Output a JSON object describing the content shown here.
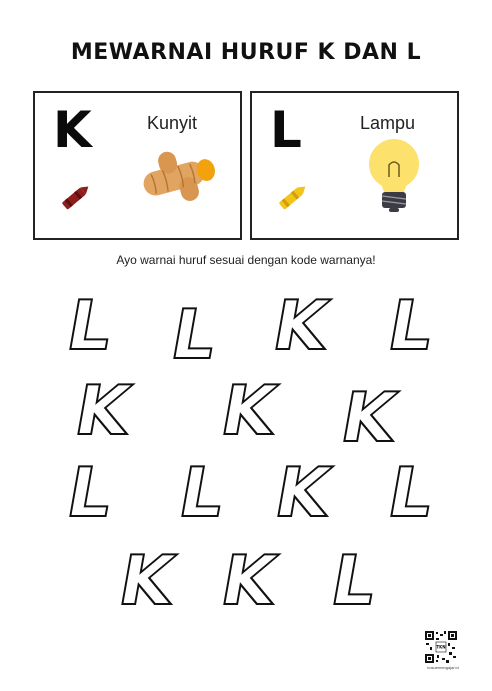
{
  "title": "MEWARNAI HURUF K DAN L",
  "cards": {
    "k": {
      "letter": "K",
      "word": "Kunyit",
      "crayon_color": "#8e1d1d"
    },
    "l": {
      "letter": "L",
      "word": "Lampu",
      "crayon_color": "#f0c419"
    }
  },
  "instruction": "Ayo warnai huruf sesuai dengan kode warnanya!",
  "letters": [
    "L",
    "L",
    "K",
    "L",
    "K",
    "K",
    "K",
    "L",
    "L",
    "K",
    "L",
    "K",
    "K",
    "L"
  ],
  "qr_label": "TKN",
  "footer": "kosuemengajar.id"
}
